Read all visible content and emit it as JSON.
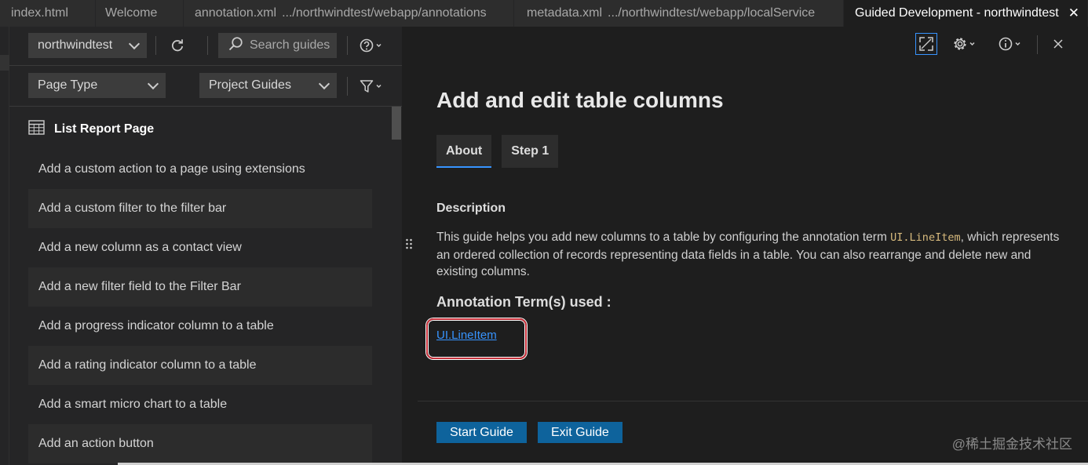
{
  "editor_tabs": [
    {
      "label": "index.html",
      "path": ""
    },
    {
      "label": "Welcome",
      "path": ""
    },
    {
      "label": "annotation.xml",
      "path": ".../northwindtest/webapp/annotations"
    },
    {
      "label": "metadata.xml",
      "path": ".../northwindtest/webapp/localService"
    },
    {
      "label": "Guided Development - northwindtest",
      "path": "",
      "active": true,
      "close": "✕"
    }
  ],
  "left_panel": {
    "project_select": "northwindtest",
    "search_placeholder": "Search guides",
    "page_type_select": "Page Type",
    "guides_select": "Project Guides",
    "group_header": "List Report Page",
    "guides": [
      "Add a custom action to a page using extensions",
      "Add a custom filter to the filter bar",
      "Add a new column as a contact view",
      "Add a new filter field to the Filter Bar",
      "Add a progress indicator column to a table",
      "Add a rating indicator column to a table",
      "Add a smart micro chart to a table",
      "Add an action button"
    ]
  },
  "guide": {
    "title": "Add and edit table columns",
    "tabs": [
      "About",
      "Step 1"
    ],
    "description_title": "Description",
    "description_before": "This guide helps you add new columns to a table by configuring the annotation term ",
    "description_code": "UI.LineItem",
    "description_after": ", which represents an ordered collection of records representing data fields in a table. You can also rearrange and delete new and existing columns.",
    "annotation_title": "Annotation Term(s) used :",
    "annotation_link": "UI.LineItem",
    "start_button": "Start Guide",
    "exit_button": "Exit Guide"
  },
  "icons": {
    "refresh": "refresh-icon",
    "search": "search-icon",
    "help": "help-icon",
    "filter": "filter-icon",
    "table": "table-icon",
    "expand": "expand-icon",
    "settings": "gear-icon",
    "info": "info-icon",
    "close": "close-icon"
  },
  "colors": {
    "accent": "#3794ff",
    "button": "#0e639c",
    "highlight_ring": "#c6303a"
  },
  "watermark": "@稀土掘金技术社区"
}
